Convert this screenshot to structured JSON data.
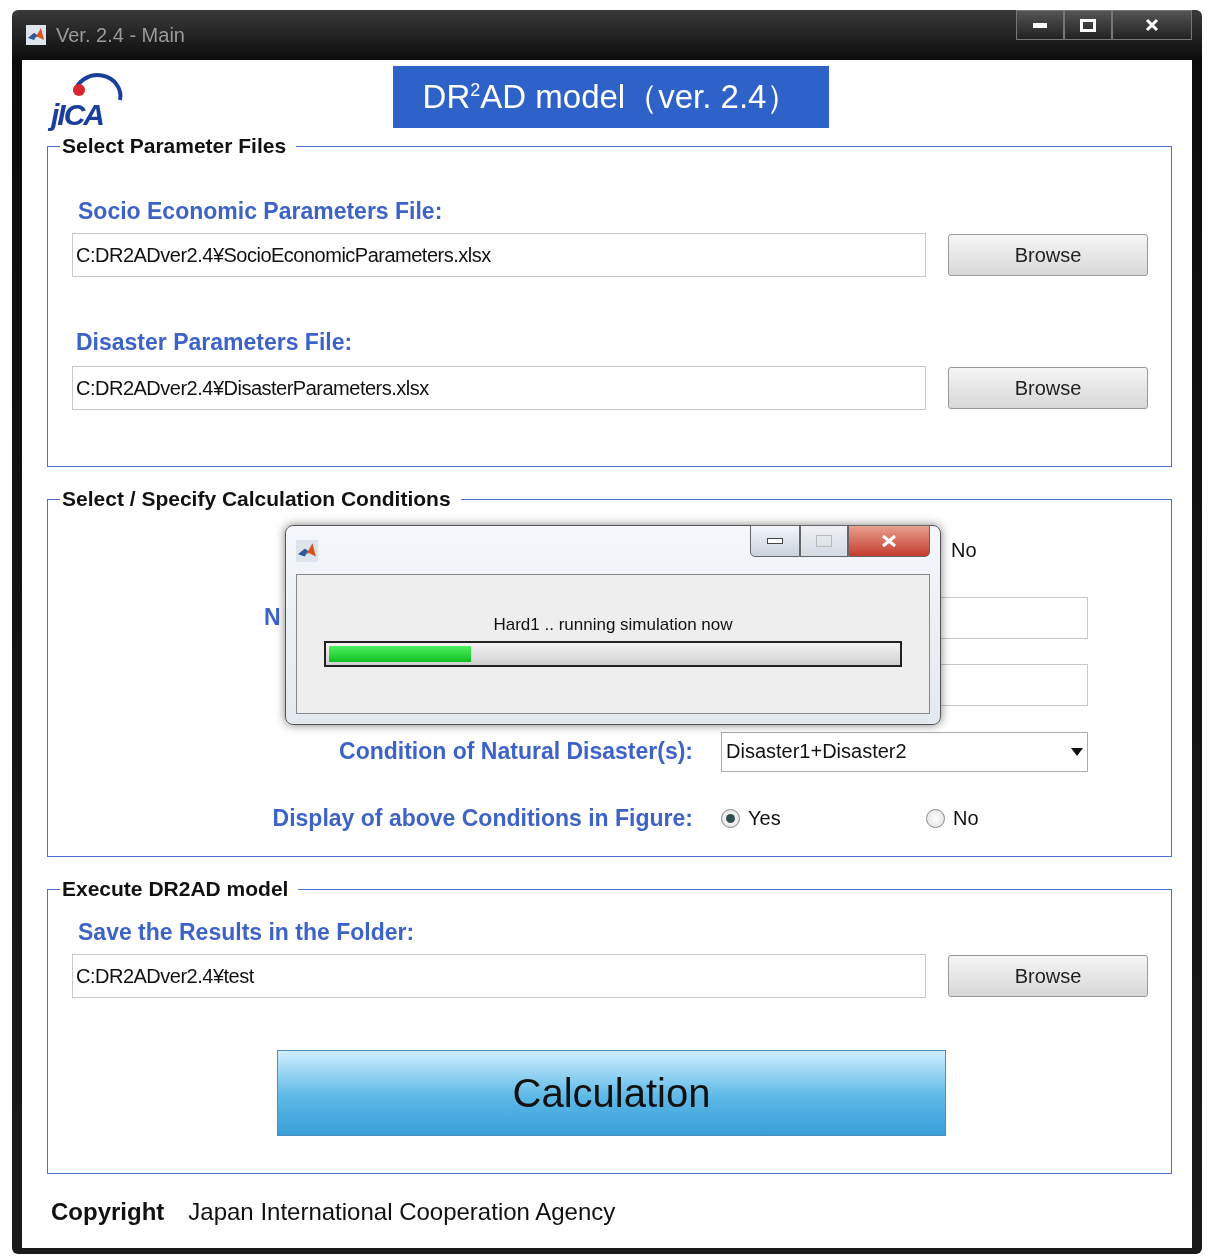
{
  "window": {
    "title": "Ver. 2.4 - Main"
  },
  "header": {
    "logo": "jICA",
    "title": "DR$^{2}$AD model（ver. 2.4）"
  },
  "parameter_files": {
    "legend": "Select Parameter Files",
    "files": [
      {
        "label": "Socio Economic Parameters File:",
        "value": "C:DR2ADver2.4¥SocioEconomicParameters.xlsx",
        "button": "Browse"
      },
      {
        "label": "Disaster Parameters File:",
        "value": "C:DR2ADver2.4¥DisasterParameters.xlsx",
        "button": "Browse"
      }
    ]
  },
  "conditions": {
    "legend": "Select / Specify Calculation Conditions",
    "rows": [
      {
        "kind": "radio",
        "options": [
          {
            "label": "No"
          }
        ]
      },
      {
        "kind": "field",
        "label": "N"
      },
      {
        "kind": "field"
      },
      {
        "kind": "select",
        "label": "Condition of Natural Disaster(s):",
        "value": "Disaster1+Disaster2"
      },
      {
        "kind": "radio",
        "label": "Display of above Conditions in Figure:",
        "options": [
          {
            "label": "Yes",
            "selected": true
          },
          {
            "label": "No",
            "selected": false
          }
        ]
      }
    ]
  },
  "execute": {
    "legend": "Execute DR2AD model",
    "label": "Save the Results in the Folder:",
    "value": "C:DR2ADver2.4¥test",
    "button": "Browse",
    "action": "Calculation"
  },
  "footer": {
    "label": "Copyright",
    "text": "Japan International Cooperation Agency"
  },
  "progress_dialog": {
    "message": "Hard1 .. running simulation now",
    "level": 0.25
  }
}
